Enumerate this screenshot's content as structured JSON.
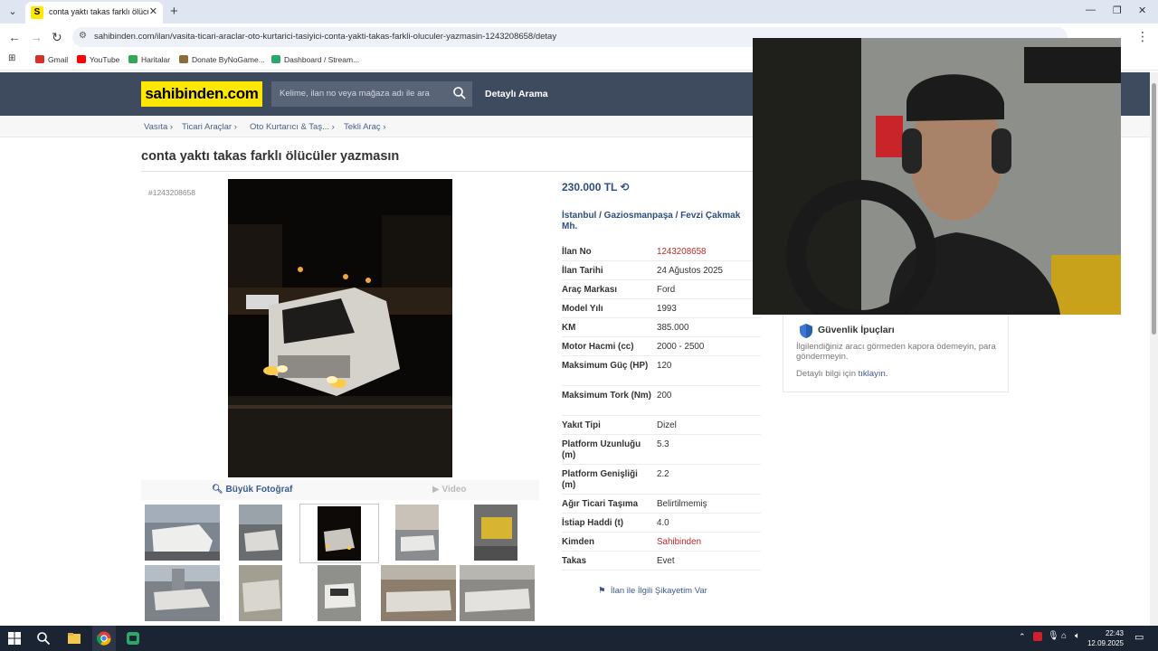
{
  "browser": {
    "tab_title": "conta yaktı takas farklı ölücüler",
    "tab_favicon": "S",
    "url": "sahibinden.com/ilan/vasita-ticari-araclar-oto-kurtarici-tasiyici-conta-yakti-takas-farkli-oluculer-yazmasin-1243208658/detay",
    "bookmarks": [
      {
        "label": "Gmail",
        "icon": "gmail-icon",
        "color": "#d93025"
      },
      {
        "label": "YouTube",
        "icon": "youtube-icon",
        "color": "#ff0000"
      },
      {
        "label": "Haritalar",
        "icon": "maps-icon",
        "color": "#34a853"
      },
      {
        "label": "Donate ByNoGame...",
        "icon": "donate-icon",
        "color": "#8a6d3b"
      },
      {
        "label": "Dashboard / Stream...",
        "icon": "stream-icon",
        "color": "#2aa86a"
      }
    ]
  },
  "site": {
    "logo": "sahibinden.com",
    "search_placeholder": "Kelime, ilan no veya mağaza adı ile ara",
    "detailed_search": "Detaylı Arama",
    "breadcrumb": [
      "Vasıta",
      "Ticari Araçlar",
      "Oto Kurtarıcı & Taş...",
      "Tekli Araç"
    ]
  },
  "listing": {
    "title": "conta yaktı takas farklı ölücüler yazmasın",
    "id_label": "#1243208658",
    "price": "230.000 TL",
    "location": "İstanbul  /  Gaziosmanpaşa  /  Fevzi Çakmak Mh.",
    "big_photo": "Büyük Fotoğraf",
    "video": "Video",
    "complaint": "İlan ile İlgili Şikayetim Var",
    "specs": [
      {
        "k": "İlan No",
        "v": "1243208658",
        "red": true
      },
      {
        "k": "İlan Tarihi",
        "v": "24 Ağustos 2025"
      },
      {
        "k": "Araç Markası",
        "v": "Ford"
      },
      {
        "k": "Model Yılı",
        "v": "1993"
      },
      {
        "k": "KM",
        "v": "385.000"
      },
      {
        "k": "Motor Hacmi (cc)",
        "v": "2000 - 2500"
      },
      {
        "k": "Maksimum Güç (HP)",
        "v": "120"
      },
      {
        "k": "Maksimum Tork (Nm)",
        "v": "200"
      },
      {
        "k": "Yakıt Tipi",
        "v": "Dizel"
      },
      {
        "k": "Platform Uzunluğu (m)",
        "v": "5.3"
      },
      {
        "k": "Platform Genişliği (m)",
        "v": "2.2"
      },
      {
        "k": "Ağır Ticari Taşıma",
        "v": "Belirtilmemiş"
      },
      {
        "k": "İstiap Haddi (t)",
        "v": "4.0"
      },
      {
        "k": "Kimden",
        "v": "Sahibinden",
        "red": true
      },
      {
        "k": "Takas",
        "v": "Evet"
      }
    ]
  },
  "safety": {
    "title": "Güvenlik İpuçları",
    "text": "İlgilendiğiniz aracı görmeden kapora ödemeyin, para göndermeyin.",
    "link_prefix": "Detaylı bilgi için",
    "link": "tıklayın."
  },
  "taskbar": {
    "time": "22:43",
    "date": "12.09.2025"
  }
}
